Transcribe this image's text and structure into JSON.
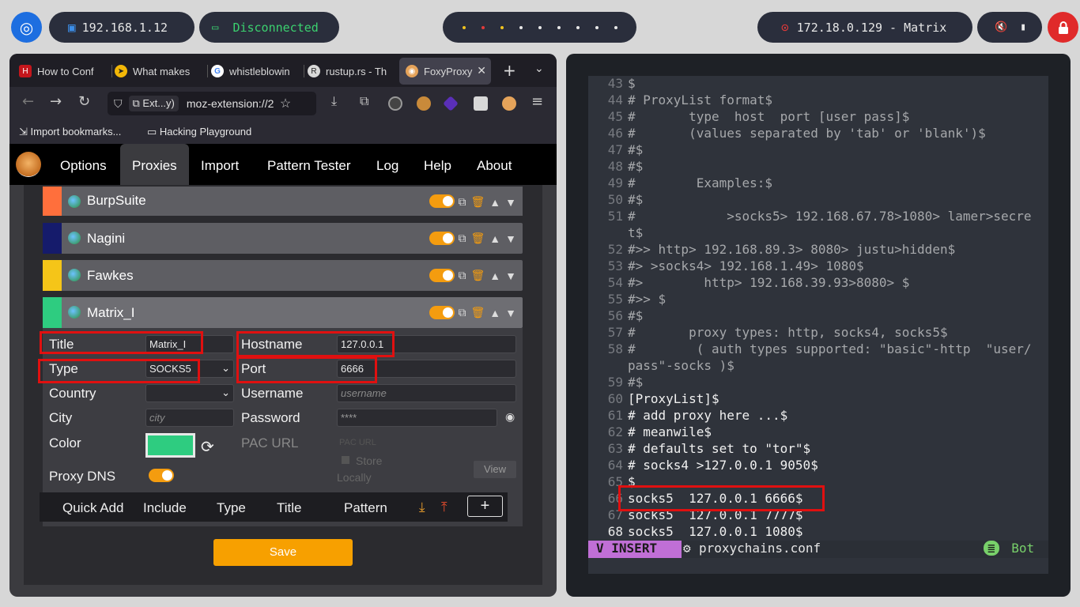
{
  "topbar": {
    "ip_local": "192.168.1.12",
    "vpn_status": "Disconnected",
    "target": "172.18.0.129 - Matrix"
  },
  "browser": {
    "tabs": [
      {
        "label": "How to Conf"
      },
      {
        "label": "What makes"
      },
      {
        "label": "whistleblowin"
      },
      {
        "label": "rustup.rs - Th"
      },
      {
        "label": "FoxyProxy",
        "active": true
      }
    ],
    "url_chip": "Ext...y)",
    "url": "moz-extension://2",
    "bookmarks": [
      "Import bookmarks...",
      "Hacking Playground"
    ]
  },
  "foxyproxy": {
    "nav": [
      "Options",
      "Proxies",
      "Import",
      "Pattern Tester",
      "Log",
      "Help",
      "About"
    ],
    "active_nav": "Proxies",
    "proxies": [
      {
        "name": "BurpSuite",
        "color": "#ff6f3c"
      },
      {
        "name": "Nagini",
        "color": "#151b6b"
      },
      {
        "name": "Fawkes",
        "color": "#f5c518"
      },
      {
        "name": "Matrix_I",
        "color": "#2ecc80"
      }
    ],
    "form": {
      "title_label": "Title",
      "title_value": "Matrix_I",
      "type_label": "Type",
      "type_value": "SOCKS5",
      "country_label": "Country",
      "city_label": "City",
      "city_placeholder": "city",
      "color_label": "Color",
      "color_value": "#2ecc80",
      "proxy_dns_label": "Proxy DNS",
      "hostname_label": "Hostname",
      "hostname_value": "127.0.0.1",
      "port_label": "Port",
      "port_value": "6666",
      "username_label": "Username",
      "username_placeholder": "username",
      "password_label": "Password",
      "password_value": "****",
      "pac_url_label": "PAC URL",
      "pac_url_placeholder": "PAC URL",
      "store_label": "Store",
      "locally_label": "Locally",
      "view_label": "View"
    },
    "quick_add_headers": [
      "Quick Add",
      "Include",
      "Type",
      "Title",
      "Pattern"
    ],
    "add_label": "+",
    "save_label": "Save"
  },
  "terminal": {
    "lines": [
      {
        "n": "43",
        "t": "$"
      },
      {
        "n": "44",
        "t": "# ProxyList format$"
      },
      {
        "n": "45",
        "t": "#       type  host  port [user pass]$"
      },
      {
        "n": "46",
        "t": "#       (values separated by 'tab' or 'blank')$"
      },
      {
        "n": "47",
        "t": "#$"
      },
      {
        "n": "48",
        "t": "#$"
      },
      {
        "n": "49",
        "t": "#        Examples:$"
      },
      {
        "n": "50",
        "t": "#$"
      },
      {
        "n": "51",
        "t": "#            >socks5> 192.168.67.78>1080> lamer>secre"
      },
      {
        "n": "",
        "t": "t$"
      },
      {
        "n": "52",
        "t": "#>> http> 192.168.89.3> 8080> justu>hidden$"
      },
      {
        "n": "53",
        "t": "#> >socks4> 192.168.1.49> 1080$"
      },
      {
        "n": "54",
        "t": "#>        http> 192.168.39.93>8080> $"
      },
      {
        "n": "55",
        "t": "#>> $"
      },
      {
        "n": "56",
        "t": "#$"
      },
      {
        "n": "57",
        "t": "#       proxy types: http, socks4, socks5$"
      },
      {
        "n": "58",
        "t": "#        ( auth types supported: \"basic\"-http  \"user/"
      },
      {
        "n": "",
        "t": "pass\"-socks )$"
      },
      {
        "n": "59",
        "t": "#$"
      },
      {
        "n": "60",
        "t": "[ProxyList]$"
      },
      {
        "n": "61",
        "t": "# add proxy here ...$"
      },
      {
        "n": "62",
        "t": "# meanwile$"
      },
      {
        "n": "63",
        "t": "# defaults set to \"tor\"$"
      },
      {
        "n": "64",
        "t": "# socks4 >127.0.0.1 9050$"
      },
      {
        "n": "65",
        "t": "$"
      },
      {
        "n": "66",
        "t": "socks5  127.0.0.1 6666$"
      },
      {
        "n": "67",
        "t": "socks5  127.0.0.1 7777$"
      },
      {
        "n": "68",
        "t": "socks5  127.0.0.1 1080$"
      }
    ],
    "mode": "INSERT",
    "filename": "proxychains.conf",
    "position": "Bot"
  }
}
